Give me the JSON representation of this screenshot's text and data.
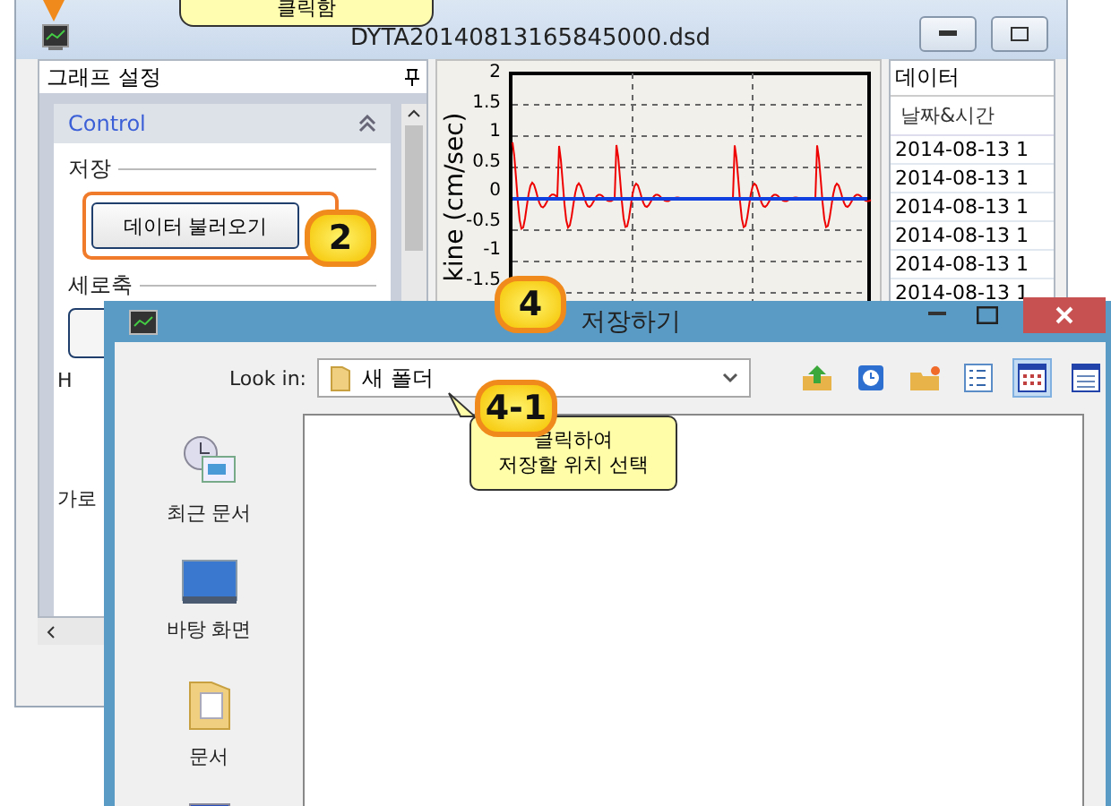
{
  "top_tooltip": {
    "text": "클릭함"
  },
  "app_window": {
    "title": "DYTA20140813165845000.dsd",
    "settings_panel": {
      "title": "그래프 설정",
      "group": {
        "title": "Control",
        "expanded": true
      },
      "sections": [
        {
          "kind": "save",
          "label": "저장",
          "button": "데이터 불러오기"
        },
        {
          "kind": "axis",
          "label": "세로축"
        },
        {
          "kind": "partial",
          "label": "H"
        },
        {
          "kind": "partial",
          "label": "가로"
        }
      ]
    },
    "chart": {
      "ylabel": "kine (cm/sec)",
      "ytick_labels": [
        "2",
        "1.5",
        "1",
        "0.5",
        "0",
        "-0.5",
        "-1",
        "-1.5"
      ]
    },
    "data_panel": {
      "title": "데이터",
      "column": "날짜&시간",
      "rows": [
        "2014-08-13 1",
        "2014-08-13 1",
        "2014-08-13 1",
        "2014-08-13 1",
        "2014-08-13 1",
        "2014-08-13 1"
      ]
    }
  },
  "dialog": {
    "title": "저장하기",
    "look_in_label": "Look in:",
    "look_in_value": "새 폴더",
    "toolbar": [
      {
        "kind": "up",
        "selected": false
      },
      {
        "kind": "recent",
        "selected": false
      },
      {
        "kind": "new-folder",
        "selected": false
      },
      {
        "kind": "list",
        "selected": false
      },
      {
        "kind": "details",
        "selected": true
      },
      {
        "kind": "grid",
        "selected": false
      }
    ],
    "places": [
      {
        "kind": "recent",
        "label": "최근 문서"
      },
      {
        "kind": "desktop",
        "label": "바탕 화면"
      },
      {
        "kind": "documents",
        "label": "문서"
      },
      {
        "kind": "computer"
      }
    ]
  },
  "badges": [
    {
      "kind": "load",
      "text": "2"
    },
    {
      "kind": "dialog",
      "text": "4"
    },
    {
      "kind": "look-in",
      "text": "4-1"
    }
  ],
  "callout": {
    "lines": [
      "클릭하여",
      "저장할 위치 선택"
    ]
  }
}
